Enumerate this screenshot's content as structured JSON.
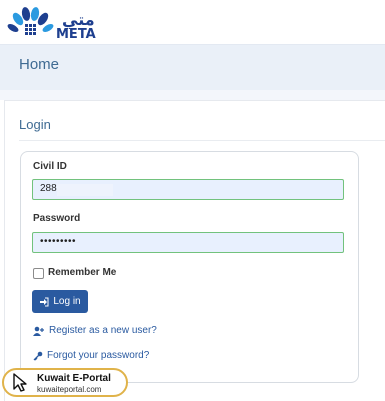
{
  "header": {
    "logo_text_arabic": "متي",
    "logo_text_latin": "META",
    "page_title": "Home"
  },
  "login": {
    "heading": "Login",
    "civil_id_label": "Civil ID",
    "civil_id_value": "288",
    "password_label": "Password",
    "password_value": "•••••••••",
    "remember_label": "Remember Me",
    "login_button": "Log in",
    "register_link": "Register as a new user?",
    "forgot_link": "Forgot your password?"
  },
  "watermark": {
    "title": "Kuwait E-Portal",
    "url": "kuwaiteportal.com"
  },
  "colors": {
    "brand_blue": "#2a5aa0",
    "title_blue": "#3f6b93",
    "input_fill": "#e8f0fe",
    "input_border_valid": "#72c27d",
    "logo_primary": "#1e3f8f",
    "logo_accent": "#2b9ae0"
  },
  "icons": [
    "meta-logo-icon",
    "sign-in-icon",
    "user-plus-icon",
    "key-icon",
    "cursor-icon"
  ]
}
